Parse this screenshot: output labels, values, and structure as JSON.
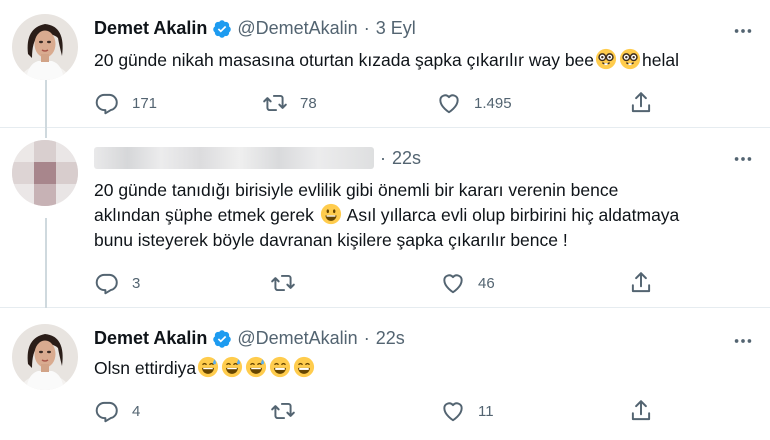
{
  "tweets": [
    {
      "author": "Demet Akalin",
      "handle": "@DemetAkalin",
      "separator": "·",
      "time": "3 Eyl",
      "text_before": "20 günde nikah masasına oturtan kızada şapka çıkarılır way bee",
      "emojis": [
        "nerd-face-emoji",
        "nerd-face-emoji"
      ],
      "text_after": "helal",
      "replies": "171",
      "retweets": "78",
      "likes": "1.495"
    },
    {
      "author": "",
      "handle": "",
      "separator": "·",
      "time": "22s",
      "lines": [
        "20 günde tanıdığı birisiyle evlilik gibi önemli bir kararı verenin bence",
        "aklından şüphe etmek gerek",
        "Asıl yıllarca evli olup birbirini hiç aldatmaya",
        "bunu isteyerek böyle davranan kişilere şapka çıkarılır bence !"
      ],
      "replies": "3",
      "retweets": "",
      "likes": "46"
    },
    {
      "author": "Demet Akalin",
      "handle": "@DemetAkalin",
      "separator": "·",
      "time": "22s",
      "text_before": "Olsn ettirdiya",
      "emojis": [
        "sweat-smile-emoji",
        "sweat-smile-emoji",
        "sweat-smile-emoji",
        "grin-emoji",
        "grin-emoji"
      ],
      "replies": "4",
      "retweets": "",
      "likes": "11"
    }
  ],
  "icons": {
    "reply": "reply-icon",
    "retweet": "retweet-icon",
    "like": "heart-icon",
    "share": "share-icon",
    "more": "more-options-icon",
    "verified": "verified-badge-icon"
  },
  "colors": {
    "icon_gray": "#536471",
    "verified_blue": "#1d9bf0",
    "divider": "#e6ecf0",
    "thread_line": "#cfd9de"
  }
}
